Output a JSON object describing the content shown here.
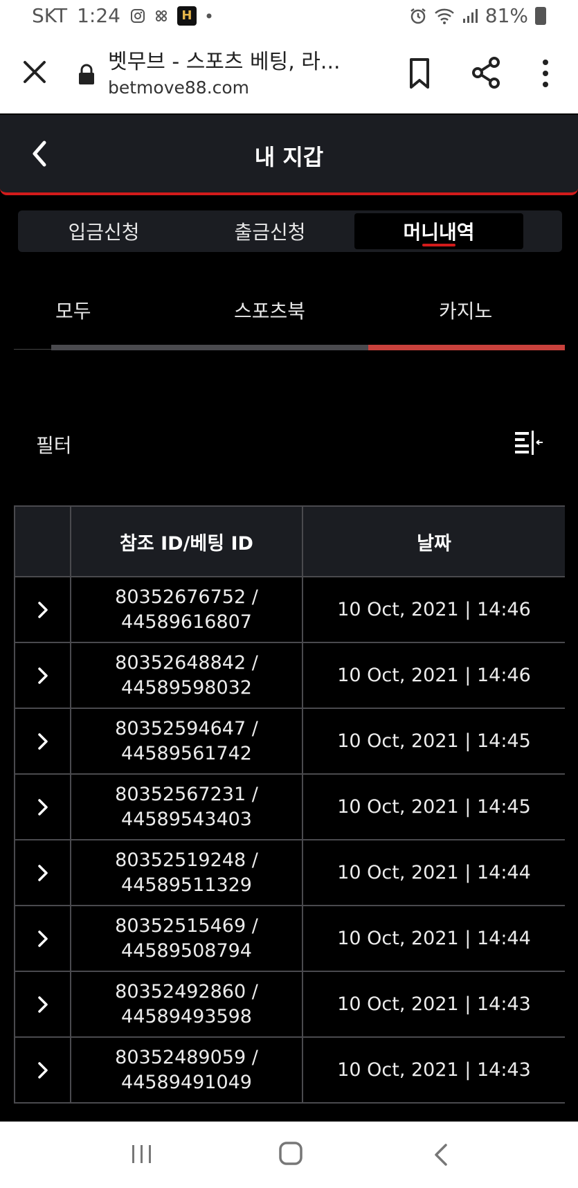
{
  "status_bar": {
    "carrier": "SKT",
    "time": "1:24",
    "app_badge": "H",
    "battery": "81%"
  },
  "browser": {
    "page_title": "벳무브 - 스포츠 베팅, 라...",
    "url": "betmove88.com"
  },
  "header": {
    "title": "내 지갑"
  },
  "main_tabs": [
    {
      "label": "입금신청",
      "active": false
    },
    {
      "label": "출금신청",
      "active": false
    },
    {
      "label": "머니내역",
      "active": true
    }
  ],
  "sub_tabs": [
    {
      "label": "모두"
    },
    {
      "label": "스포츠북"
    },
    {
      "label": "카지노",
      "active": true
    }
  ],
  "filter": {
    "label": "필터"
  },
  "table": {
    "headers": [
      "",
      "참조 ID/베팅 ID",
      "날짜"
    ],
    "rows": [
      {
        "ref_id": "80352676752 /",
        "bet_id": "44589616807",
        "date": "10 Oct, 2021 | 14:46"
      },
      {
        "ref_id": "80352648842 /",
        "bet_id": "44589598032",
        "date": "10 Oct, 2021 | 14:46"
      },
      {
        "ref_id": "80352594647 /",
        "bet_id": "44589561742",
        "date": "10 Oct, 2021 | 14:45"
      },
      {
        "ref_id": "80352567231 /",
        "bet_id": "44589543403",
        "date": "10 Oct, 2021 | 14:45"
      },
      {
        "ref_id": "80352519248 /",
        "bet_id": "44589511329",
        "date": "10 Oct, 2021 | 14:44"
      },
      {
        "ref_id": "80352515469 /",
        "bet_id": "44589508794",
        "date": "10 Oct, 2021 | 14:44"
      },
      {
        "ref_id": "80352492860 /",
        "bet_id": "44589493598",
        "date": "10 Oct, 2021 | 14:43"
      },
      {
        "ref_id": "80352489059 /",
        "bet_id": "44589491049",
        "date": "10 Oct, 2021 | 14:43"
      }
    ]
  },
  "colors": {
    "accent": "#d21b1b",
    "panel": "#1b1d22",
    "background": "#000000",
    "progress_red": "#c9413c"
  }
}
